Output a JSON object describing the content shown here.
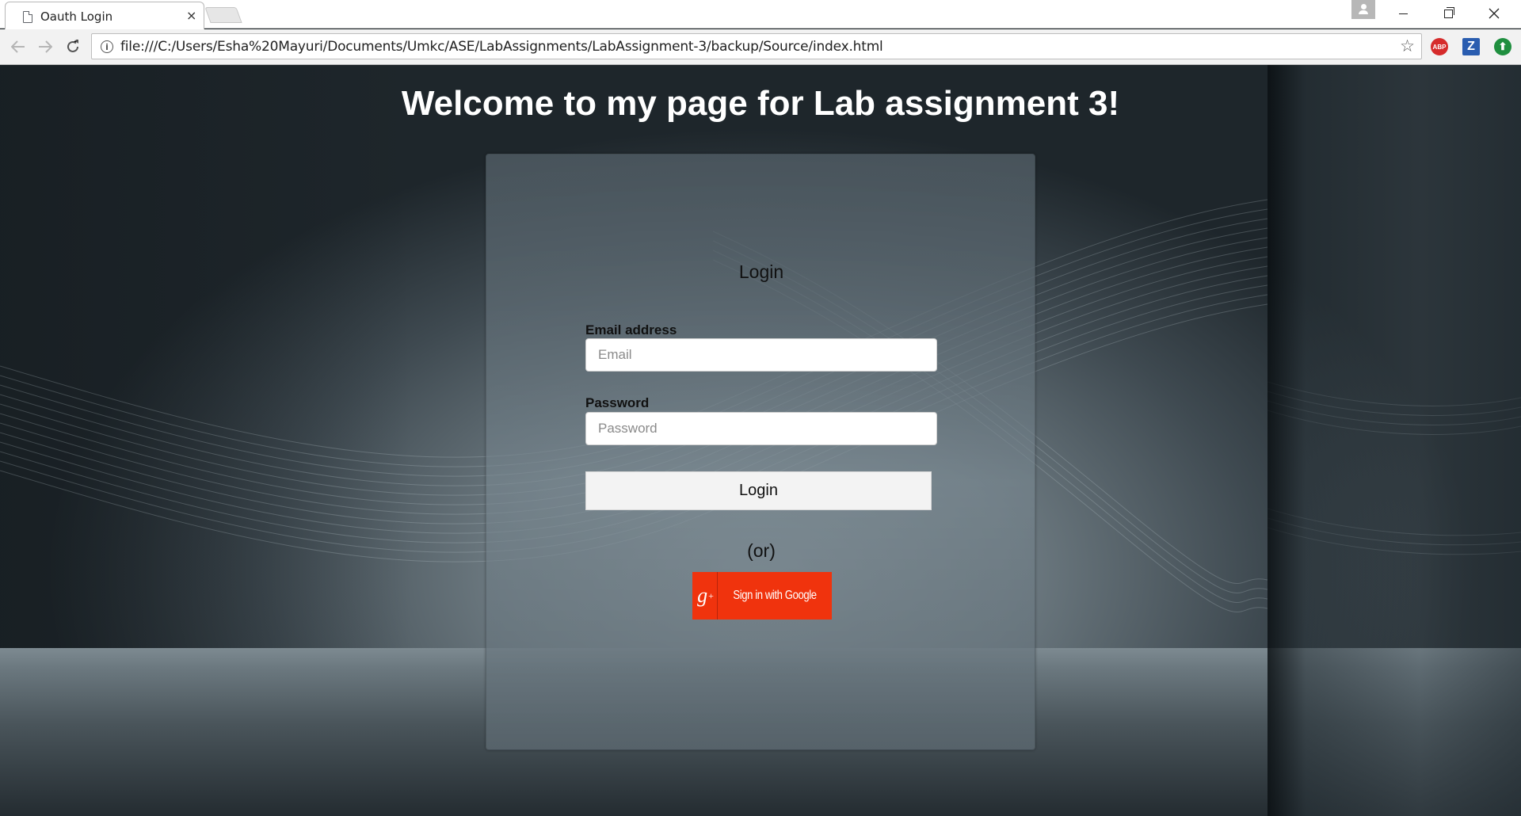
{
  "browser": {
    "tab_title": "Oauth Login",
    "tab_close": "×",
    "url": "file:///C:/Users/Esha%20Mayuri/Documents/Umkc/ASE/LabAssignments/LabAssignment-3/backup/Source/index.html",
    "extensions": {
      "abp_label": "ABP",
      "z_label": "Z",
      "green_label": "⬆"
    }
  },
  "page": {
    "welcome_heading": "Welcome to my page for Lab assignment 3!",
    "login_title": "Login",
    "email_label": "Email address",
    "email_placeholder": "Email",
    "password_label": "Password",
    "password_placeholder": "Password",
    "login_button": "Login",
    "or_text": "(or)",
    "google_icon_letter": "g",
    "google_icon_plus": "+",
    "google_button": "Sign in with Google"
  },
  "colors": {
    "google_red": "#f0330d",
    "page_bg": "#1c2328"
  }
}
